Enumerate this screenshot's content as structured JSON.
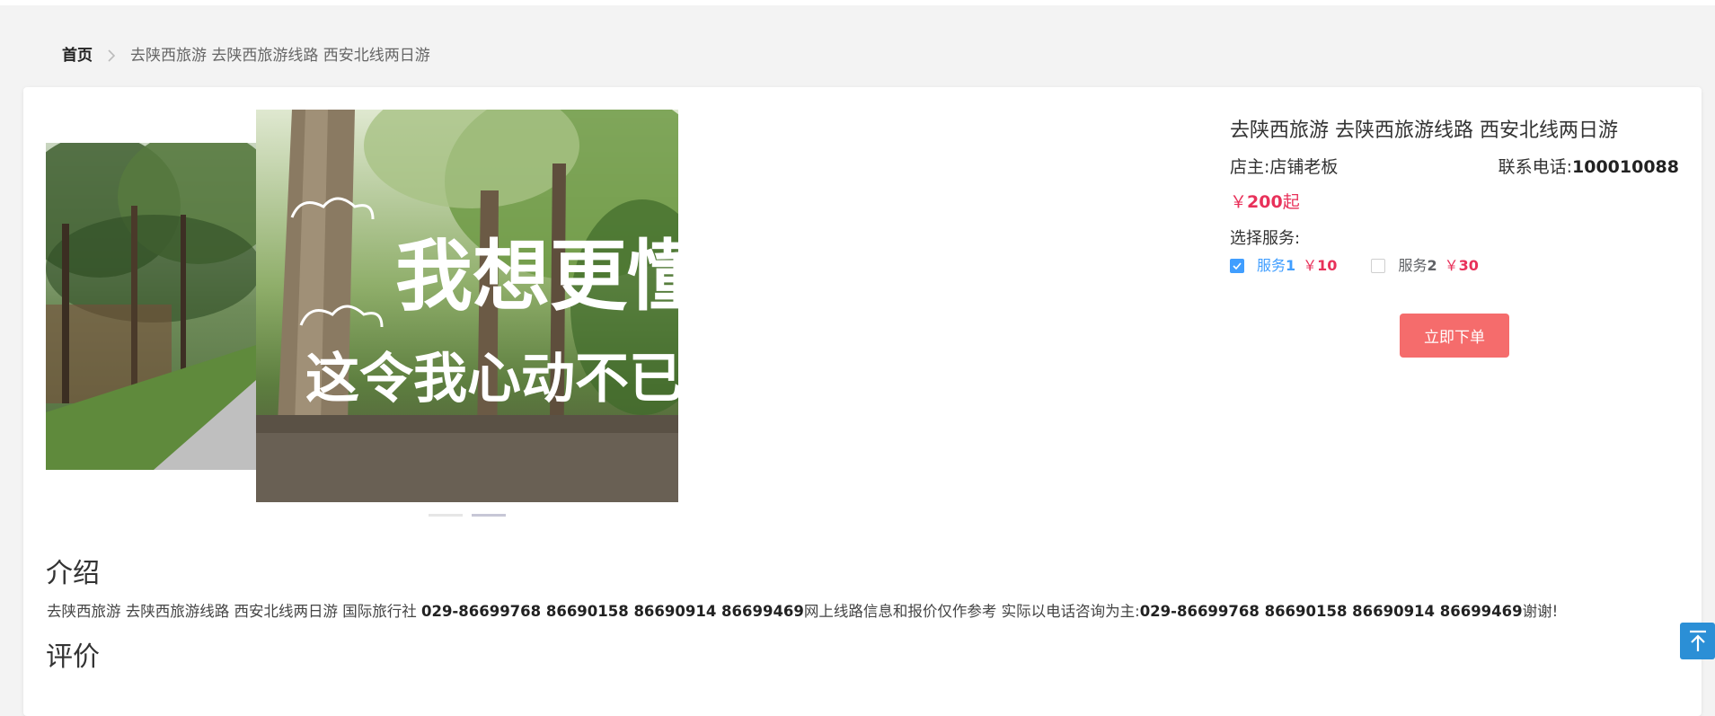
{
  "breadcrumb": {
    "home": "首页",
    "current": "去陕西旅游 去陕西旅游线路 西安北线两日游"
  },
  "carousel": {
    "front_overlay_line1": "我想更懂",
    "front_overlay_line2": "这令我心动不已的",
    "slides_count": 2,
    "active_index": 1
  },
  "product": {
    "title": "去陕西旅游 去陕西旅游线路 西安北线两日游",
    "owner_label": "店主:",
    "owner_name": "店铺老板",
    "phone_label": "联系电话:",
    "phone": "100010088",
    "price_symbol": "￥",
    "price": "200",
    "price_suffix": "起"
  },
  "services": {
    "label": "选择服务:",
    "items": [
      {
        "name": "服务",
        "index": "1",
        "currency": "￥",
        "price": "10",
        "checked": true
      },
      {
        "name": "服务",
        "index": "2",
        "currency": "￥",
        "price": "30",
        "checked": false
      }
    ]
  },
  "order_button": "立即下单",
  "intro": {
    "title": "介绍",
    "part1": "去陕西旅游 去陕西旅游线路 西安北线两日游 国际旅行社 ",
    "phones1": "029-86699768 86690158 86690914 86699469",
    "part2": "网上线路信息和报价仅作参考 实际以电话咨询为主:",
    "phones2": "029-86699768 86690158 86690914 86699469",
    "part3": "谢谢!"
  },
  "review": {
    "title": "评价"
  },
  "colors": {
    "accent_red": "#e8315a",
    "button_red": "#f56c6c",
    "checkbox_blue": "#409eff",
    "back_top_blue": "#2b8fd6"
  },
  "icons": {
    "breadcrumb_separator": "chevron-right-icon",
    "checkbox_checked": "check-icon",
    "back_to_top": "arrow-up-to-top-icon"
  }
}
